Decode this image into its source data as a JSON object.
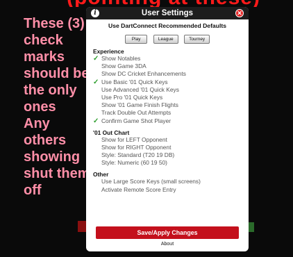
{
  "banner_text": "(pointing at these)",
  "note_lines": [
    "These (3)",
    "check",
    "marks",
    "should be",
    "the only",
    "ones",
    "Any",
    "others",
    "showing",
    "shut them",
    "off"
  ],
  "dialog": {
    "title": "User Settings",
    "defaults_heading": "Use DartConnect Recommended Defaults",
    "default_buttons": [
      "Play",
      "League",
      "Tourney"
    ],
    "sections": [
      {
        "title": "Experience",
        "items": [
          {
            "label": "Show Notables",
            "checked": true
          },
          {
            "label": "Show Game 3DA",
            "checked": false
          },
          {
            "label": "Show DC Cricket Enhancements",
            "checked": false
          },
          {
            "label": "Use Basic '01 Quick Keys",
            "checked": true
          },
          {
            "label": "Use Advanced '01 Quick Keys",
            "checked": false
          },
          {
            "label": "Use Pro '01 Quick Keys",
            "checked": false
          },
          {
            "label": "Show '01 Game Finish Flights",
            "checked": false
          },
          {
            "label": "Track Double Out Attempts",
            "checked": false
          },
          {
            "label": "Confirm Game Shot Player",
            "checked": true
          }
        ]
      },
      {
        "title": "'01 Out Chart",
        "items": [
          {
            "label": "Show for LEFT Opponent",
            "checked": false
          },
          {
            "label": "Show for RIGHT Opponent",
            "checked": false
          },
          {
            "label": "Style: Standard (T20 19 DB)",
            "checked": false
          },
          {
            "label": "Style: Numeric (60 19 50)",
            "checked": false
          }
        ]
      },
      {
        "title": "Other",
        "items": [
          {
            "label": "Use Large Score Keys (small screens)",
            "checked": false
          },
          {
            "label": "Activate Remote Score Entry",
            "checked": false
          }
        ]
      }
    ],
    "save_label": "Save/Apply Changes",
    "about_label": "About",
    "check_glyph": "✓",
    "info_glyph": "i",
    "close_glyph": "✕"
  },
  "colors": {
    "accent_red": "#c4101c",
    "check_green": "#2e9e2e",
    "note_pink": "#ff8fa8"
  }
}
